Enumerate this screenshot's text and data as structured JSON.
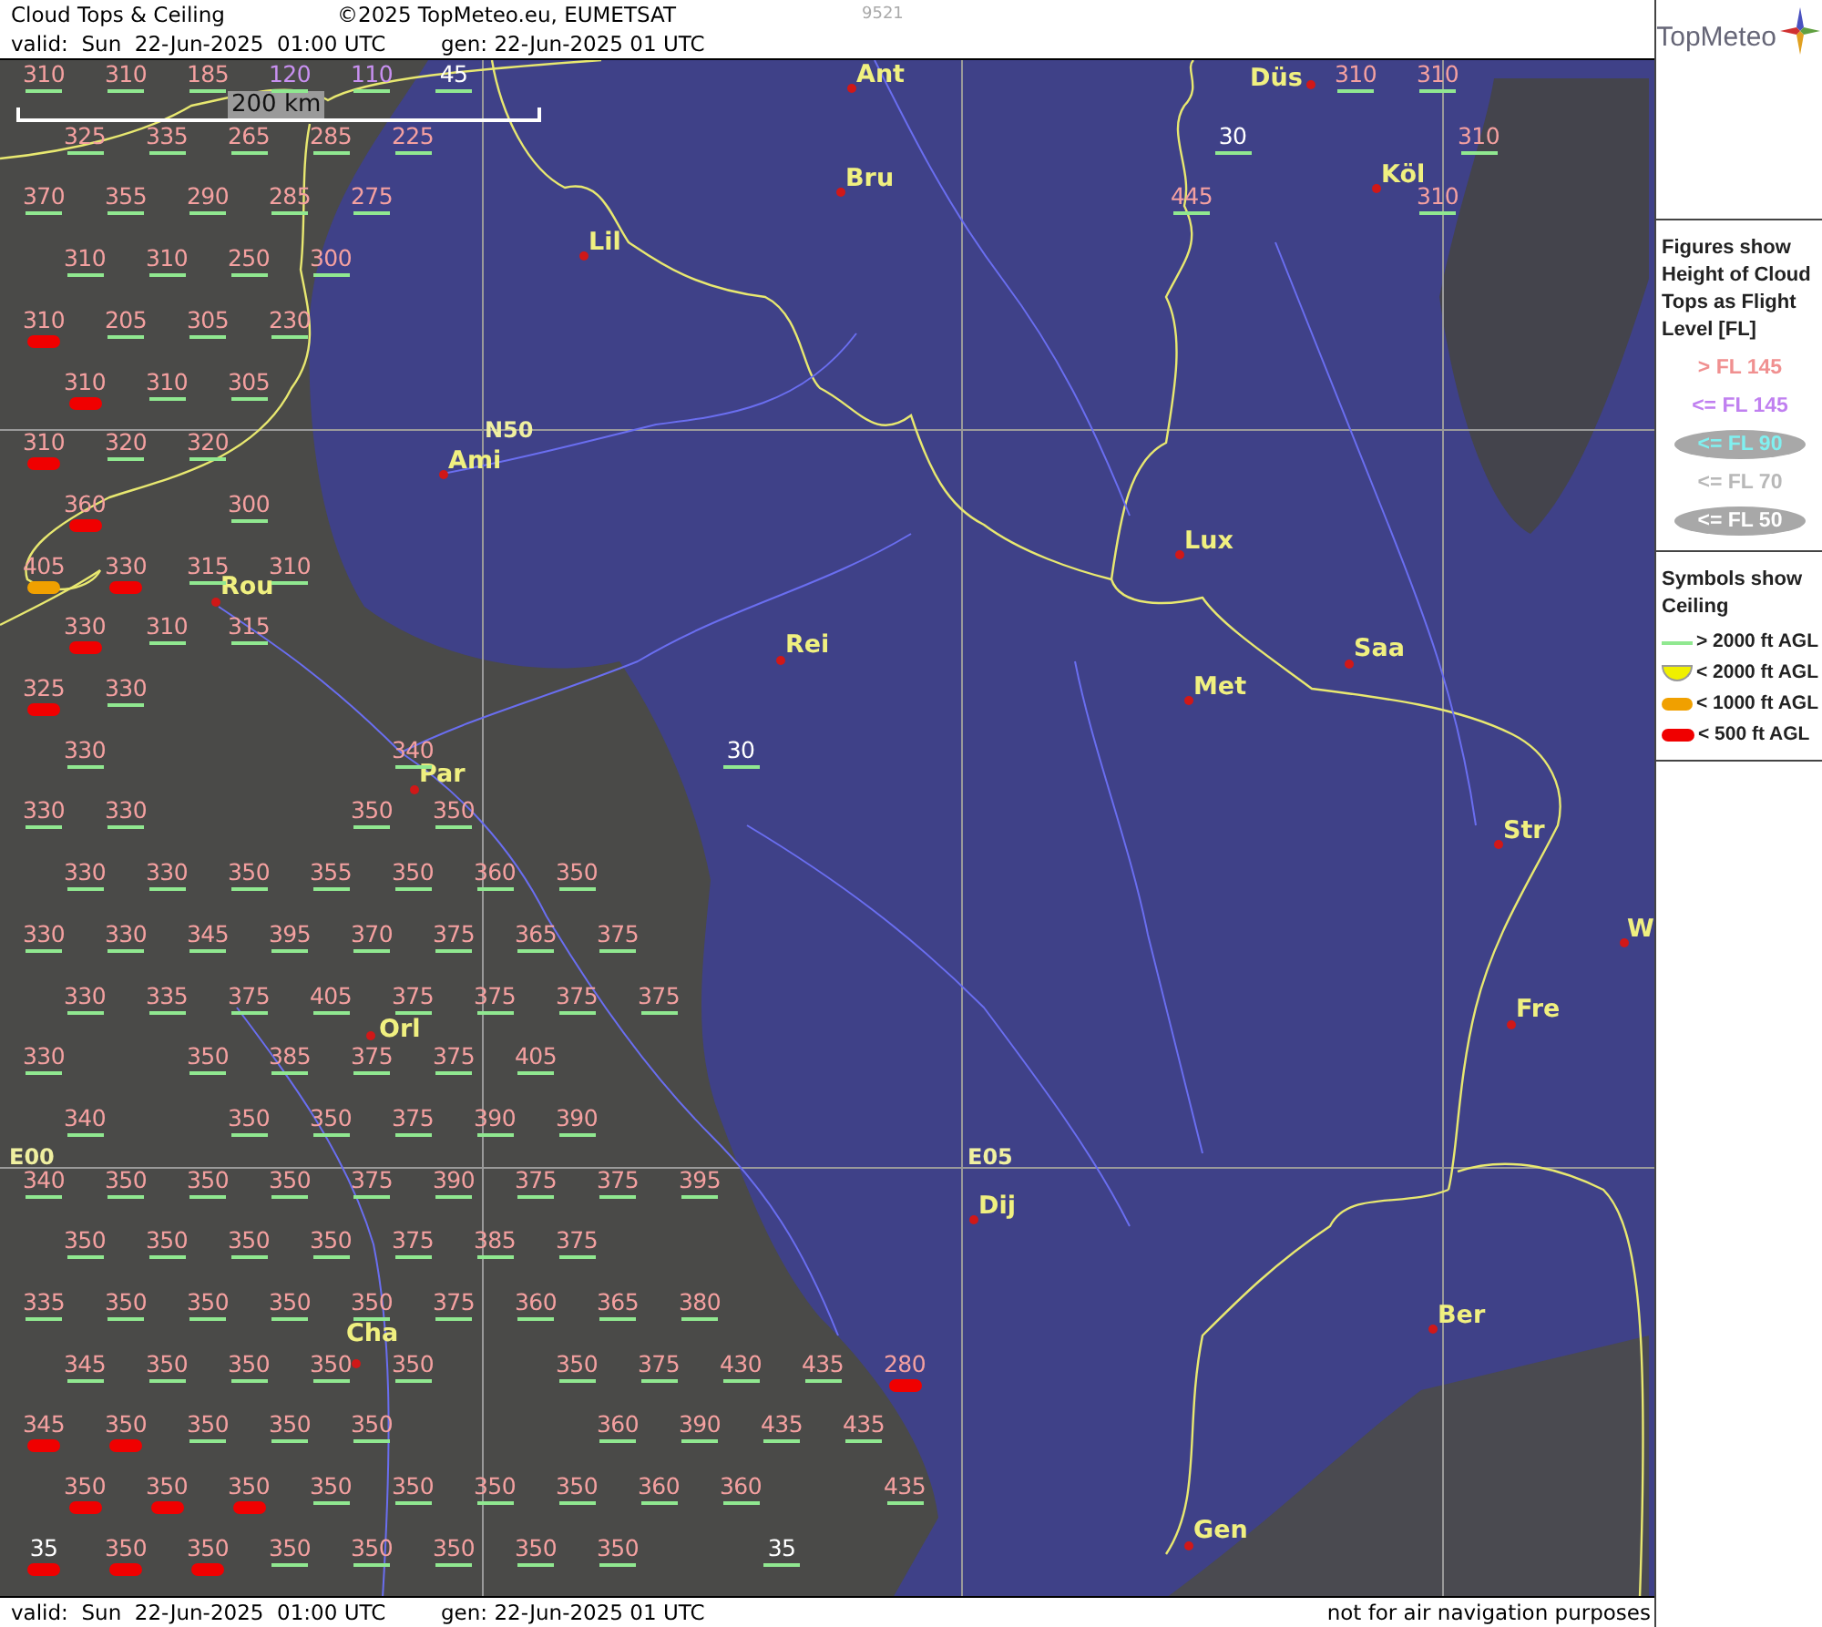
{
  "header": {
    "title": "Cloud Tops & Ceiling",
    "copyright": "©2025 TopMeteo.eu, EUMETSAT",
    "code": "9521",
    "valid": "valid:  Sun  22-Jun-2025  01:00 UTC",
    "gen": "gen: 22-Jun-2025 01 UTC"
  },
  "logo": {
    "text": "TopMeteo"
  },
  "scale": {
    "label": "200 km"
  },
  "grid_labels": [
    "N50",
    "E00",
    "E05"
  ],
  "cities": [
    {
      "name": "Ant"
    },
    {
      "name": "Bru"
    },
    {
      "name": "Lil"
    },
    {
      "name": "Düs"
    },
    {
      "name": "Köl"
    },
    {
      "name": "Ami"
    },
    {
      "name": "Rou"
    },
    {
      "name": "Rei"
    },
    {
      "name": "Par"
    },
    {
      "name": "Lux"
    },
    {
      "name": "Met"
    },
    {
      "name": "Saa"
    },
    {
      "name": "Str"
    },
    {
      "name": "W"
    },
    {
      "name": "Fre"
    },
    {
      "name": "Orl"
    },
    {
      "name": "Cha"
    },
    {
      "name": "Dij"
    },
    {
      "name": "Ber"
    },
    {
      "name": "Gen"
    }
  ],
  "observations": [
    {
      "cells": [
        {
          "value": "310",
          "color": "#f4a0a0",
          "kind": "gt2000"
        },
        {
          "value": "310",
          "color": "#f4a0a0",
          "kind": "gt2000"
        },
        {
          "value": "185",
          "color": "#f4a0a0",
          "kind": "gt2000"
        },
        {
          "value": "120",
          "color": "#c890f0",
          "kind": "gt2000"
        },
        {
          "value": "110",
          "color": "#c890f0",
          "kind": "gt2000"
        },
        {
          "value": "45",
          "color": "#ffffff",
          "kind": "gt2000"
        },
        null,
        null,
        null,
        null,
        null,
        null,
        null,
        null,
        null,
        null,
        {
          "value": "310",
          "color": "#f4a0a0",
          "kind": "gt2000"
        },
        {
          "value": "310",
          "color": "#f4a0a0",
          "kind": "gt2000"
        }
      ]
    },
    {
      "cells": [
        {
          "value": "325",
          "color": "#f4a0a0",
          "kind": "gt2000"
        },
        {
          "value": "335",
          "color": "#f4a0a0",
          "kind": "gt2000"
        },
        {
          "value": "265",
          "color": "#f4a0a0",
          "kind": "gt2000"
        },
        {
          "value": "285",
          "color": "#f4a0a0",
          "kind": "gt2000"
        },
        {
          "value": "225",
          "color": "#f4a0a0",
          "kind": "gt2000"
        },
        null,
        null,
        null,
        null,
        null,
        null,
        null,
        null,
        null,
        {
          "value": "30",
          "color": "#ffffff",
          "kind": "gt2000"
        },
        null,
        null,
        {
          "value": "310",
          "color": "#f4a0a0",
          "kind": "gt2000"
        }
      ]
    },
    {
      "cells": [
        {
          "value": "370",
          "color": "#f4a0a0",
          "kind": "gt2000"
        },
        {
          "value": "355",
          "color": "#f4a0a0",
          "kind": "gt2000"
        },
        {
          "value": "290",
          "color": "#f4a0a0",
          "kind": "gt2000"
        },
        {
          "value": "285",
          "color": "#f4a0a0",
          "kind": "gt2000"
        },
        {
          "value": "275",
          "color": "#f4a0a0",
          "kind": "gt2000"
        },
        null,
        null,
        null,
        null,
        null,
        null,
        null,
        null,
        null,
        {
          "value": "445",
          "color": "#f4a0a0",
          "kind": "gt2000"
        },
        null,
        null,
        {
          "value": "310",
          "color": "#f4a0a0",
          "kind": "gt2000"
        }
      ]
    },
    {
      "cells": [
        {
          "value": "310",
          "color": "#f4a0a0",
          "kind": "gt2000"
        },
        {
          "value": "310",
          "color": "#f4a0a0",
          "kind": "gt2000"
        },
        {
          "value": "250",
          "color": "#f4a0a0",
          "kind": "gt2000"
        },
        {
          "value": "300",
          "color": "#f4a0a0",
          "kind": "gt2000"
        }
      ]
    },
    {
      "cells": [
        {
          "value": "310",
          "color": "#f4a0a0",
          "kind": "lt500"
        },
        {
          "value": "205",
          "color": "#f4a0a0",
          "kind": "gt2000"
        },
        {
          "value": "305",
          "color": "#f4a0a0",
          "kind": "gt2000"
        },
        {
          "value": "230",
          "color": "#f4a0a0",
          "kind": "gt2000"
        }
      ]
    },
    {
      "cells": [
        {
          "value": "310",
          "color": "#f4a0a0",
          "kind": "lt500"
        },
        {
          "value": "310",
          "color": "#f4a0a0",
          "kind": "gt2000"
        },
        {
          "value": "305",
          "color": "#f4a0a0",
          "kind": "gt2000"
        }
      ]
    },
    {
      "cells": [
        {
          "value": "310",
          "color": "#f4a0a0",
          "kind": "lt500"
        },
        {
          "value": "320",
          "color": "#f4a0a0",
          "kind": "gt2000"
        },
        {
          "value": "320",
          "color": "#f4a0a0",
          "kind": "gt2000"
        }
      ]
    },
    {
      "cells": [
        {
          "value": "360",
          "color": "#f4a0a0",
          "kind": "lt500"
        },
        null,
        {
          "value": "300",
          "color": "#f4a0a0",
          "kind": "gt2000"
        }
      ]
    },
    {
      "cells": [
        {
          "value": "405",
          "color": "#f4a0a0",
          "kind": "lt1000"
        },
        {
          "value": "330",
          "color": "#f4a0a0",
          "kind": "lt500"
        },
        {
          "value": "315",
          "color": "#f4a0a0",
          "kind": "gt2000"
        },
        {
          "value": "310",
          "color": "#f4a0a0",
          "kind": "gt2000"
        }
      ]
    },
    {
      "cells": [
        {
          "value": "330",
          "color": "#f4a0a0",
          "kind": "lt500"
        },
        {
          "value": "310",
          "color": "#f4a0a0",
          "kind": "gt2000"
        },
        {
          "value": "315",
          "color": "#f4a0a0",
          "kind": "gt2000"
        }
      ]
    },
    {
      "cells": [
        {
          "value": "325",
          "color": "#f4a0a0",
          "kind": "lt500"
        },
        {
          "value": "330",
          "color": "#f4a0a0",
          "kind": "gt2000"
        }
      ]
    },
    {
      "cells": [
        {
          "value": "330",
          "color": "#f4a0a0",
          "kind": "gt2000"
        },
        null,
        null,
        null,
        {
          "value": "340",
          "color": "#f4a0a0",
          "kind": "gt2000"
        },
        null,
        null,
        null,
        {
          "value": "30",
          "color": "#ffffff",
          "kind": "gt2000"
        }
      ]
    },
    {
      "cells": [
        {
          "value": "330",
          "color": "#f4a0a0",
          "kind": "gt2000"
        },
        {
          "value": "330",
          "color": "#f4a0a0",
          "kind": "gt2000"
        },
        null,
        null,
        {
          "value": "350",
          "color": "#f4a0a0",
          "kind": "gt2000"
        },
        {
          "value": "350",
          "color": "#f4a0a0",
          "kind": "gt2000"
        }
      ]
    },
    {
      "cells": [
        {
          "value": "330",
          "color": "#f4a0a0",
          "kind": "gt2000"
        },
        {
          "value": "330",
          "color": "#f4a0a0",
          "kind": "gt2000"
        },
        {
          "value": "350",
          "color": "#f4a0a0",
          "kind": "gt2000"
        },
        {
          "value": "355",
          "color": "#f4a0a0",
          "kind": "gt2000"
        },
        {
          "value": "350",
          "color": "#f4a0a0",
          "kind": "gt2000"
        },
        {
          "value": "360",
          "color": "#f4a0a0",
          "kind": "gt2000"
        },
        {
          "value": "350",
          "color": "#f4a0a0",
          "kind": "gt2000"
        }
      ]
    },
    {
      "cells": [
        {
          "value": "330",
          "color": "#f4a0a0",
          "kind": "gt2000"
        },
        {
          "value": "330",
          "color": "#f4a0a0",
          "kind": "gt2000"
        },
        {
          "value": "345",
          "color": "#f4a0a0",
          "kind": "gt2000"
        },
        {
          "value": "395",
          "color": "#f4a0a0",
          "kind": "gt2000"
        },
        {
          "value": "370",
          "color": "#f4a0a0",
          "kind": "gt2000"
        },
        {
          "value": "375",
          "color": "#f4a0a0",
          "kind": "gt2000"
        },
        {
          "value": "365",
          "color": "#f4a0a0",
          "kind": "gt2000"
        },
        {
          "value": "375",
          "color": "#f4a0a0",
          "kind": "gt2000"
        }
      ]
    },
    {
      "cells": [
        {
          "value": "330",
          "color": "#f4a0a0",
          "kind": "gt2000"
        },
        {
          "value": "335",
          "color": "#f4a0a0",
          "kind": "gt2000"
        },
        {
          "value": "375",
          "color": "#f4a0a0",
          "kind": "gt2000"
        },
        {
          "value": "405",
          "color": "#f4a0a0",
          "kind": "gt2000"
        },
        {
          "value": "375",
          "color": "#f4a0a0",
          "kind": "gt2000"
        },
        {
          "value": "375",
          "color": "#f4a0a0",
          "kind": "gt2000"
        },
        {
          "value": "375",
          "color": "#f4a0a0",
          "kind": "gt2000"
        },
        {
          "value": "375",
          "color": "#f4a0a0",
          "kind": "gt2000"
        }
      ]
    },
    {
      "cells": [
        {
          "value": "330",
          "color": "#f4a0a0",
          "kind": "gt2000"
        },
        null,
        {
          "value": "350",
          "color": "#f4a0a0",
          "kind": "gt2000"
        },
        {
          "value": "385",
          "color": "#f4a0a0",
          "kind": "gt2000"
        },
        {
          "value": "375",
          "color": "#f4a0a0",
          "kind": "gt2000"
        },
        {
          "value": "375",
          "color": "#f4a0a0",
          "kind": "gt2000"
        },
        {
          "value": "405",
          "color": "#f4a0a0",
          "kind": "gt2000"
        }
      ]
    },
    {
      "cells": [
        {
          "value": "340",
          "color": "#f4a0a0",
          "kind": "gt2000"
        },
        null,
        {
          "value": "350",
          "color": "#f4a0a0",
          "kind": "gt2000"
        },
        {
          "value": "350",
          "color": "#f4a0a0",
          "kind": "gt2000"
        },
        {
          "value": "375",
          "color": "#f4a0a0",
          "kind": "gt2000"
        },
        {
          "value": "390",
          "color": "#f4a0a0",
          "kind": "gt2000"
        },
        {
          "value": "390",
          "color": "#f4a0a0",
          "kind": "gt2000"
        }
      ]
    },
    {
      "cells": [
        {
          "value": "340",
          "color": "#f4a0a0",
          "kind": "gt2000"
        },
        {
          "value": "350",
          "color": "#f4a0a0",
          "kind": "gt2000"
        },
        {
          "value": "350",
          "color": "#f4a0a0",
          "kind": "gt2000"
        },
        {
          "value": "350",
          "color": "#f4a0a0",
          "kind": "gt2000"
        },
        {
          "value": "375",
          "color": "#f4a0a0",
          "kind": "gt2000"
        },
        {
          "value": "390",
          "color": "#f4a0a0",
          "kind": "gt2000"
        },
        {
          "value": "375",
          "color": "#f4a0a0",
          "kind": "gt2000"
        },
        {
          "value": "375",
          "color": "#f4a0a0",
          "kind": "gt2000"
        },
        {
          "value": "395",
          "color": "#f4a0a0",
          "kind": "gt2000"
        }
      ]
    },
    {
      "cells": [
        {
          "value": "350",
          "color": "#f4a0a0",
          "kind": "gt2000"
        },
        {
          "value": "350",
          "color": "#f4a0a0",
          "kind": "gt2000"
        },
        {
          "value": "350",
          "color": "#f4a0a0",
          "kind": "gt2000"
        },
        {
          "value": "350",
          "color": "#f4a0a0",
          "kind": "gt2000"
        },
        {
          "value": "375",
          "color": "#f4a0a0",
          "kind": "gt2000"
        },
        {
          "value": "385",
          "color": "#f4a0a0",
          "kind": "gt2000"
        },
        {
          "value": "375",
          "color": "#f4a0a0",
          "kind": "gt2000"
        }
      ]
    },
    {
      "cells": [
        {
          "value": "335",
          "color": "#f4a0a0",
          "kind": "gt2000"
        },
        {
          "value": "350",
          "color": "#f4a0a0",
          "kind": "gt2000"
        },
        {
          "value": "350",
          "color": "#f4a0a0",
          "kind": "gt2000"
        },
        {
          "value": "350",
          "color": "#f4a0a0",
          "kind": "gt2000"
        },
        {
          "value": "350",
          "color": "#f4a0a0",
          "kind": "gt2000"
        },
        {
          "value": "375",
          "color": "#f4a0a0",
          "kind": "gt2000"
        },
        {
          "value": "360",
          "color": "#f4a0a0",
          "kind": "gt2000"
        },
        {
          "value": "365",
          "color": "#f4a0a0",
          "kind": "gt2000"
        },
        {
          "value": "380",
          "color": "#f4a0a0",
          "kind": "gt2000"
        }
      ]
    },
    {
      "cells": [
        {
          "value": "345",
          "color": "#f4a0a0",
          "kind": "gt2000"
        },
        {
          "value": "350",
          "color": "#f4a0a0",
          "kind": "gt2000"
        },
        {
          "value": "350",
          "color": "#f4a0a0",
          "kind": "gt2000"
        },
        {
          "value": "350",
          "color": "#f4a0a0",
          "kind": "gt2000"
        },
        {
          "value": "350",
          "color": "#f4a0a0",
          "kind": "gt2000"
        },
        null,
        {
          "value": "350",
          "color": "#f4a0a0",
          "kind": "gt2000"
        },
        {
          "value": "375",
          "color": "#f4a0a0",
          "kind": "gt2000"
        },
        {
          "value": "430",
          "color": "#f4a0a0",
          "kind": "gt2000"
        },
        {
          "value": "435",
          "color": "#f4a0a0",
          "kind": "gt2000"
        },
        {
          "value": "280",
          "color": "#f4a0a0",
          "kind": "lt500"
        }
      ]
    },
    {
      "cells": [
        {
          "value": "345",
          "color": "#f4a0a0",
          "kind": "lt500"
        },
        {
          "value": "350",
          "color": "#f4a0a0",
          "kind": "lt500"
        },
        {
          "value": "350",
          "color": "#f4a0a0",
          "kind": "gt2000"
        },
        {
          "value": "350",
          "color": "#f4a0a0",
          "kind": "gt2000"
        },
        {
          "value": "350",
          "color": "#f4a0a0",
          "kind": "gt2000"
        },
        null,
        null,
        {
          "value": "360",
          "color": "#f4a0a0",
          "kind": "gt2000"
        },
        {
          "value": "390",
          "color": "#f4a0a0",
          "kind": "gt2000"
        },
        {
          "value": "435",
          "color": "#f4a0a0",
          "kind": "gt2000"
        },
        {
          "value": "435",
          "color": "#f4a0a0",
          "kind": "gt2000"
        }
      ]
    },
    {
      "cells": [
        {
          "value": "350",
          "color": "#f4a0a0",
          "kind": "lt500"
        },
        {
          "value": "350",
          "color": "#f4a0a0",
          "kind": "lt500"
        },
        {
          "value": "350",
          "color": "#f4a0a0",
          "kind": "lt500"
        },
        {
          "value": "350",
          "color": "#f4a0a0",
          "kind": "gt2000"
        },
        {
          "value": "350",
          "color": "#f4a0a0",
          "kind": "gt2000"
        },
        {
          "value": "350",
          "color": "#f4a0a0",
          "kind": "gt2000"
        },
        {
          "value": "350",
          "color": "#f4a0a0",
          "kind": "gt2000"
        },
        {
          "value": "360",
          "color": "#f4a0a0",
          "kind": "gt2000"
        },
        {
          "value": "360",
          "color": "#f4a0a0",
          "kind": "gt2000"
        },
        null,
        {
          "value": "435",
          "color": "#f4a0a0",
          "kind": "gt2000"
        }
      ]
    },
    {
      "cells": [
        {
          "value": "35",
          "color": "#ffffff",
          "kind": "lt500"
        },
        {
          "value": "350",
          "color": "#f4a0a0",
          "kind": "lt500"
        },
        {
          "value": "350",
          "color": "#f4a0a0",
          "kind": "lt500"
        },
        {
          "value": "350",
          "color": "#f4a0a0",
          "kind": "gt2000"
        },
        {
          "value": "350",
          "color": "#f4a0a0",
          "kind": "gt2000"
        },
        {
          "value": "350",
          "color": "#f4a0a0",
          "kind": "gt2000"
        },
        {
          "value": "350",
          "color": "#f4a0a0",
          "kind": "gt2000"
        },
        {
          "value": "350",
          "color": "#f4a0a0",
          "kind": "gt2000"
        },
        null,
        {
          "value": "35",
          "color": "#ffffff",
          "kind": "gt2000"
        }
      ]
    }
  ],
  "legend": {
    "tops_title": "Figures show Height of Cloud Tops as Flight Level  [FL]",
    "tops": [
      {
        "label": "> FL 145",
        "color": "#f09090",
        "oval": false
      },
      {
        "label": "<= FL 145",
        "color": "#c080f0",
        "oval": false
      },
      {
        "label": "<= FL 90",
        "color": "#80f0f0",
        "oval": true
      },
      {
        "label": "<= FL 70",
        "color": "#b8b8b8",
        "oval": false
      },
      {
        "label": "<= FL 50",
        "color": "#ffffff",
        "oval": true
      }
    ],
    "ceiling_title": "Symbols show Ceiling",
    "ceiling": [
      {
        "label": "> 2000 ft AGL",
        "kind": "gt2000"
      },
      {
        "label": "< 2000 ft AGL",
        "kind": "lt2000"
      },
      {
        "label": "< 1000 ft AGL",
        "kind": "lt1000"
      },
      {
        "label": "< 500 ft AGL",
        "kind": "lt500"
      }
    ]
  },
  "footer": {
    "valid": "valid:  Sun  22-Jun-2025  01:00 UTC",
    "gen": "gen: 22-Jun-2025 01 UTC",
    "note": "not for air navigation purposes"
  }
}
